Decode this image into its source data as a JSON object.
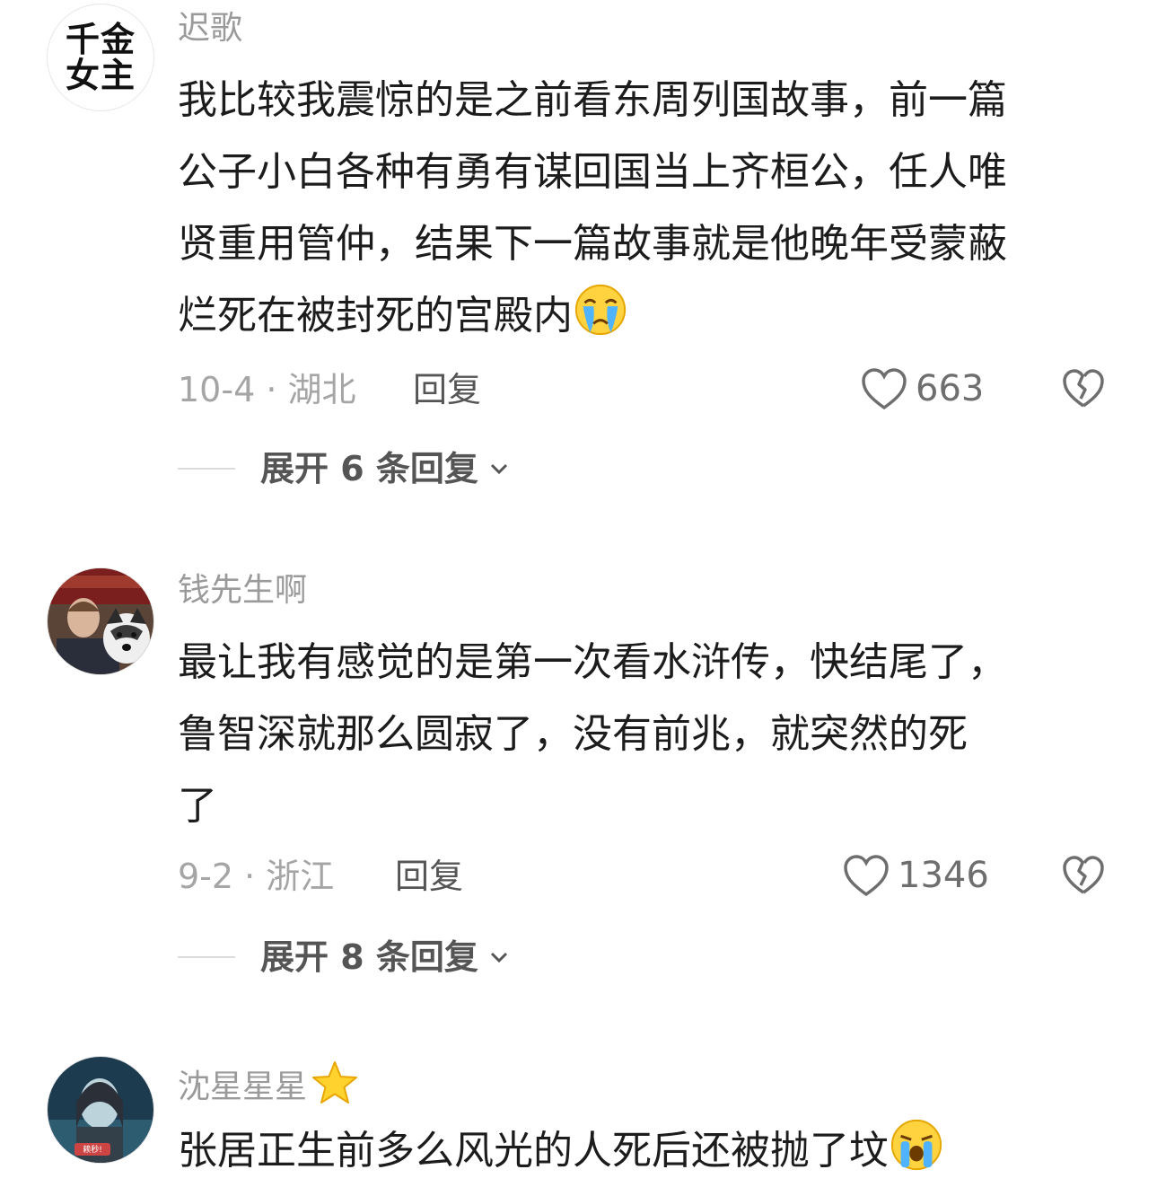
{
  "comments": [
    {
      "avatar_text_line1": "千金",
      "avatar_text_line2": "女主",
      "username": "迟歌",
      "text_lines": [
        "我比较我震惊的是之前看东周列国故事，前一篇",
        "公子小白各种有勇有谋回国当上齐桓公，任人唯",
        "贤重用管仲，结果下一篇故事就是他晚年受蒙蔽",
        "烂死在被封死的宫殿内"
      ],
      "emoji": "crying-face-emoji",
      "date_location": "10-4 · 湖北",
      "reply_label": "回复",
      "likes": "663",
      "expand_label": "展开 6 条回复"
    },
    {
      "username": "钱先生啊",
      "text_lines": [
        "最让我有感觉的是第一次看水浒传，快结尾了，",
        "鲁智深就那么圆寂了，没有前兆，就突然的死",
        "了"
      ],
      "date_location": "9-2 · 浙江",
      "reply_label": "回复",
      "likes": "1346",
      "expand_label": "展开 8 条回复"
    },
    {
      "username": "沈星星星",
      "username_badge": "star-icon",
      "avatar_caption": "赖秒!",
      "text_lines": [
        "张居正生前多么风光的人死后还被抛了坟"
      ],
      "emoji": "loudly-crying-face-emoji"
    }
  ],
  "colors": {
    "username": "#9a9a9a",
    "body": "#1c1c1c",
    "meta": "#a5a5a5",
    "action": "#555555"
  }
}
